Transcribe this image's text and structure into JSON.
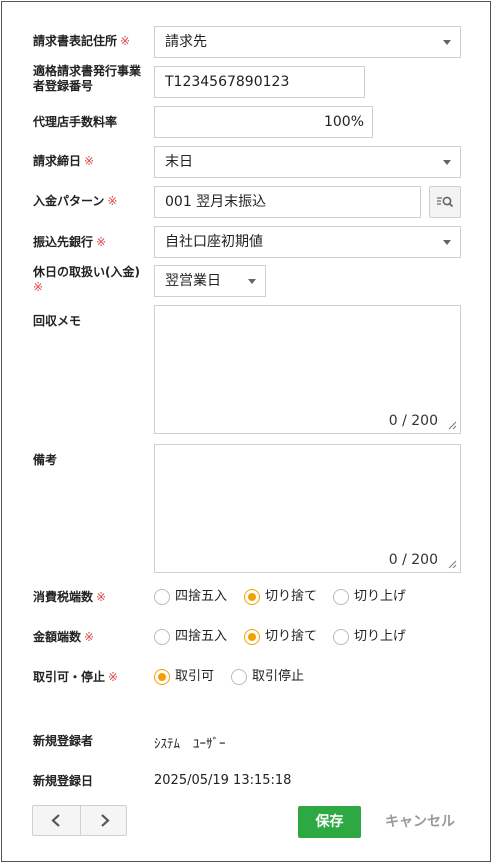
{
  "form": {
    "invoice_address": {
      "label": "請求書表記住所",
      "required": "※",
      "value": "請求先"
    },
    "registration_no": {
      "label_line1": "適格請求書発行事業",
      "label_line2": "者登録番号",
      "value": "T1234567890123"
    },
    "agent_fee_rate": {
      "label": "代理店手数料率",
      "value": "100%"
    },
    "closing_day": {
      "label": "請求締日",
      "required": "※",
      "value": "末日"
    },
    "payment_pattern": {
      "label": "入金パターン",
      "required": "※",
      "value": "001 翌月末振込",
      "search_icon": "list-search-icon"
    },
    "bank": {
      "label": "振込先銀行",
      "required": "※",
      "value": "自社口座初期値"
    },
    "holiday_handling": {
      "label": "休日の取扱い(入金)",
      "required": "※",
      "value": "翌営業日"
    },
    "collection_memo": {
      "label": "回収メモ",
      "count": "0 / 200"
    },
    "remarks": {
      "label": "備考",
      "count": "0 / 200"
    },
    "tax_rounding": {
      "label": "消費税端数",
      "required": "※",
      "options": [
        "四捨五入",
        "切り捨て",
        "切り上げ"
      ],
      "selected": "切り捨て"
    },
    "amount_rounding": {
      "label": "金額端数",
      "required": "※",
      "options": [
        "四捨五入",
        "切り捨て",
        "切り上げ"
      ],
      "selected": "切り捨て"
    },
    "trade_status": {
      "label": "取引可・停止",
      "required": "※",
      "options": [
        "取引可",
        "取引停止"
      ],
      "selected": "取引可"
    },
    "created_by": {
      "label": "新規登録者",
      "value": "ｼｽﾃﾑ　ﾕｰｻﾞｰ"
    },
    "created_at": {
      "label": "新規登録日",
      "value": "2025/05/19 13:15:18"
    }
  },
  "footer": {
    "save": "保存",
    "cancel": "キャンセル"
  },
  "colors": {
    "accent": "#f5a000",
    "save": "#2ea843",
    "required": "#e04a4a"
  }
}
